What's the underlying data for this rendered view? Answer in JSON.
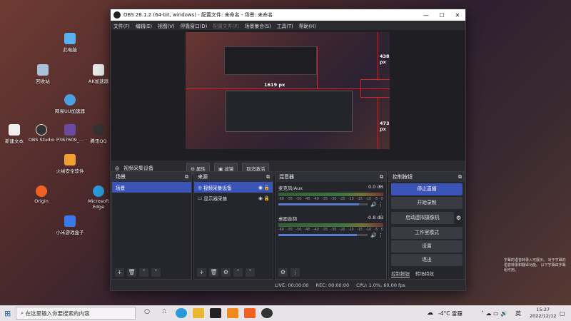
{
  "desktop": {
    "icons": [
      {
        "label": "此电脑",
        "color": "#5ab0f0"
      },
      {
        "label": "回收站",
        "color": "#a8c0d8"
      },
      {
        "label": "AK加速器",
        "color": "#e8e8e8"
      },
      {
        "label": "网易UU加速器",
        "color": "#4aa0e0"
      },
      {
        "label": "新建文本",
        "color": "#f0f0f0"
      },
      {
        "label": "OBS Studio",
        "color": "#333"
      },
      {
        "label": "P367609_...",
        "color": "#6a4aa0"
      },
      {
        "label": "腾讯QQ",
        "color": "#333"
      },
      {
        "label": "火绒安全软件",
        "color": "#f0a030"
      },
      {
        "label": "Origin",
        "color": "#f06020"
      },
      {
        "label": "Microsoft Edge",
        "color": "#2a9ad8"
      },
      {
        "label": "小米游戏盒子",
        "color": "#3a7ae8"
      }
    ]
  },
  "window": {
    "title": "OBS 28.1.2 (64-bit, windows) - 配置文件: 未命名 - 场景: 未命名",
    "controls": [
      "—",
      "☐",
      "✕"
    ]
  },
  "menu": {
    "items": [
      "文件(F)",
      "编辑(E)",
      "视图(V)",
      "停靠窗口(D)",
      "配置文件(P)",
      "场景集合(S)",
      "工具(T)",
      "帮助(H)"
    ]
  },
  "preview": {
    "label_438": "438 px",
    "label_1619": "1619 px",
    "label_473": "473 px"
  },
  "source_bar": {
    "name": "视频采集设备",
    "props": "属性",
    "filters": "滤镜",
    "deactivate": "取消激活"
  },
  "scenes": {
    "title": "场景",
    "items": [
      "场景"
    ]
  },
  "sources": {
    "title": "来源",
    "items": [
      "视频采集设备",
      "显示器采集"
    ]
  },
  "mixer": {
    "title": "混音器",
    "tracks": [
      {
        "name": "麦克风/Aux",
        "db": "0.0 dB",
        "level": 0.9
      },
      {
        "name": "桌面音频",
        "db": "-0.8 dB",
        "level": 0.88
      }
    ],
    "scale": [
      "-60",
      "-55",
      "-50",
      "-45",
      "-40",
      "-35",
      "-30",
      "-25",
      "-20",
      "-15",
      "-10",
      "-5",
      "0"
    ]
  },
  "controls": {
    "title": "控制按钮",
    "buttons": [
      "停止直播",
      "开始录制",
      "启动虚拟摄像机",
      "工作室模式",
      "设置",
      "退出"
    ],
    "tabs": [
      "控制按钮",
      "转场特效"
    ]
  },
  "status": {
    "live": "LIVE: 00:00:00",
    "rec": "REC: 00:00:00",
    "cpu": "CPU: 1.0%, 60.00 fps"
  },
  "taskbar": {
    "search": "在这里输入你要搜索的内容",
    "weather": "-4°C 雷霾",
    "lang": "英",
    "time": "15:27",
    "date": "2022/12/12"
  },
  "notification": "字幕的语音转录入可展示。 对于字幕的语音转录和翻译功能。 以下字幕由字幕组可用。"
}
